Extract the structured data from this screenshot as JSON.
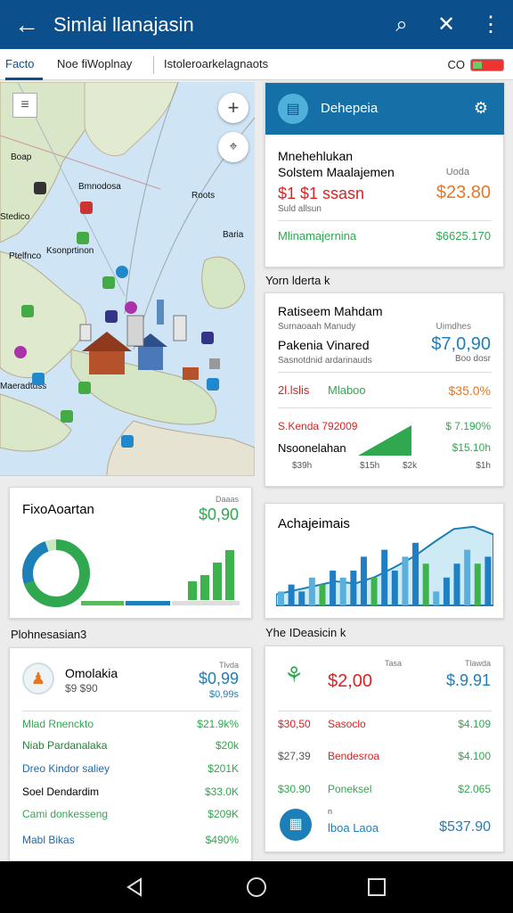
{
  "app": {
    "title": "Simlai llanajasin"
  },
  "tabs": [
    "Facto",
    "Noe fiWoplnay",
    "Istoleroarkelagnaots"
  ],
  "tabs_status": "CO",
  "map_labels": [
    "Boap",
    "Bmnodosa",
    "Roots",
    "Stedico",
    "Ksonprtinon",
    "Baria",
    "Ptelfnco",
    "Maeradtuss"
  ],
  "summary": {
    "title": "Dehepeia",
    "name": "Mnehehlukan",
    "sub": "Solstem Maalajemen",
    "note": "Uoda",
    "value_red": "$1 $1 ssasn",
    "value_orange": "$23.80",
    "caption": "Suld allsun",
    "green_label": "Mlinamajernina",
    "green_value": "$6625.170"
  },
  "fin": {
    "section_title": "Yorn lderta k",
    "title": "Ratiseem Mahdam",
    "sub": "Surnaoaah Manudy",
    "right_note": "Uimdhes",
    "label": "Pakenia Vinared",
    "value": "$7,0,90",
    "caption": "Sasnotdnid ardarinauds",
    "caption2": "Boo dosr",
    "r1_left": "2l.lslis",
    "r1_mid": "Mlaboo",
    "r1_right": "$35.0%",
    "r2_left": "S.Kenda 792009",
    "r2_right": "$ 7.190%",
    "r3_label": "Nsoonelahan",
    "r3_right": "$15.10h",
    "ticks": [
      "$39h",
      "$15h",
      "$2k",
      "$1h"
    ]
  },
  "donut": {
    "title": "FixoAoartan",
    "note": "Daaas",
    "value": "$0,90"
  },
  "area": {
    "title": "Achajeimais"
  },
  "list_left": {
    "section_title": "Plohnesasian3",
    "header": "Omolakia",
    "header_sub": "$9 $90",
    "header_note": "Tlvda",
    "header_value": "$0,99",
    "header_value2": "$0,99s",
    "rows": [
      {
        "label": "Mlad Rnenckto",
        "value": "$21.9k%"
      },
      {
        "label": "Niab Pardanalaka",
        "value": "$20k"
      },
      {
        "label": "Dreo Kindor saliey",
        "value": "$201K"
      },
      {
        "label": "Soel Dendardim",
        "value": "$33.0K"
      },
      {
        "label": "Cami donkesseng",
        "value": "$209K"
      },
      {
        "label": "Mabl Bikas",
        "value": "$490%"
      }
    ]
  },
  "list_right": {
    "section_title": "Yhe IDeasicin k",
    "top_note": "Tasa",
    "top_right_note": "Tlawda",
    "top_value": "$2,00",
    "top_right_value": "$.9.91",
    "rows": [
      {
        "left": "$30,50",
        "mid": "Sasoclo",
        "right": "$4.109"
      },
      {
        "left": "$27,39",
        "mid": "Bendesroa",
        "right": "$4.100"
      },
      {
        "left": "$30.90",
        "mid": "Poneksel",
        "right": "$2.065"
      }
    ],
    "bottom_mid_note": "n",
    "bottom_mid": "lboa Laoa",
    "bottom_value": "$537.90"
  },
  "chart_data": [
    {
      "type": "bar",
      "values": [
        3,
        4,
        6,
        8
      ],
      "title": "",
      "note": "small green bars in FixoAoartan card"
    },
    {
      "type": "area",
      "values": [
        10,
        14,
        18,
        22,
        20,
        26,
        35,
        45,
        58,
        70,
        72,
        65
      ],
      "title": "Achajeimais"
    },
    {
      "type": "bar",
      "values": [
        2,
        3,
        2,
        4,
        3,
        5,
        4,
        5,
        7,
        4,
        8,
        5,
        7,
        9,
        6,
        2,
        4,
        6,
        8,
        6,
        7
      ]
    }
  ],
  "colors": {
    "primary": "#0b4f8c",
    "green": "#2fa84f",
    "red": "#d22",
    "orange": "#e87722",
    "blue": "#1d7fb8"
  }
}
